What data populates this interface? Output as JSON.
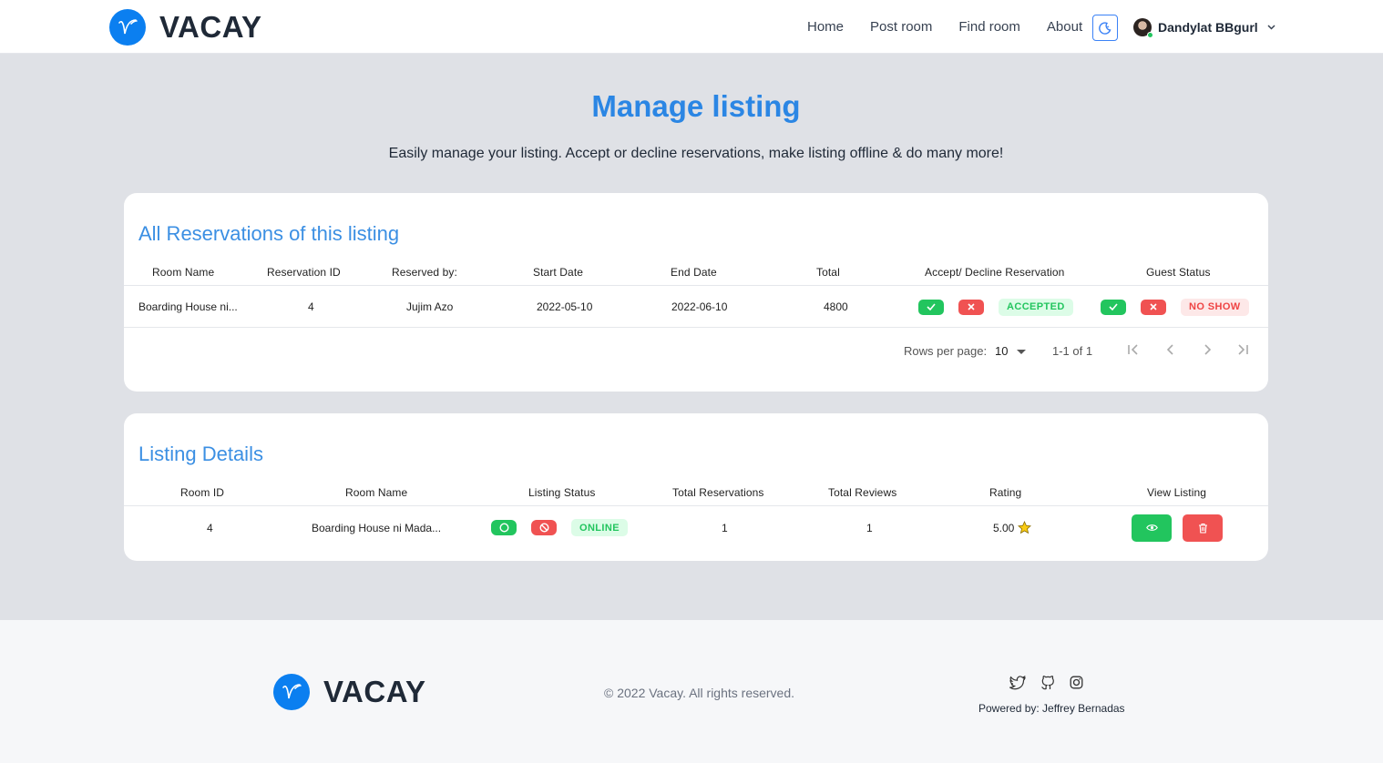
{
  "brand": {
    "name": "VACAY"
  },
  "nav": {
    "links": [
      "Home",
      "Post room",
      "Find room",
      "About"
    ],
    "user_name": "Dandylat BBgurl"
  },
  "page": {
    "title": "Manage listing",
    "subtitle": "Easily manage your listing. Accept or decline reservations, make listing offline & do many more!"
  },
  "reservations": {
    "title": "All Reservations of this listing",
    "columns": [
      "Room Name",
      "Reservation ID",
      "Reserved by:",
      "Start Date",
      "End Date",
      "Total",
      "Accept/ Decline Reservation",
      "Guest Status"
    ],
    "rows": [
      {
        "room_name": "Boarding House ni...",
        "reservation_id": "4",
        "reserved_by": "Jujim Azo",
        "start_date": "2022-05-10",
        "end_date": "2022-06-10",
        "total": "4800",
        "reservation_status": "ACCEPTED",
        "guest_status": "NO SHOW"
      }
    ],
    "pagination": {
      "rows_label": "Rows per page:",
      "rows_value": "10",
      "range": "1-1 of 1"
    }
  },
  "listing": {
    "title": "Listing Details",
    "columns": [
      "Room ID",
      "Room Name",
      "Listing Status",
      "Total Reservations",
      "Total Reviews",
      "Rating",
      "View Listing"
    ],
    "row": {
      "room_id": "4",
      "room_name": "Boarding House ni Mada...",
      "status": "ONLINE",
      "total_reservations": "1",
      "total_reviews": "1",
      "rating": "5.00"
    }
  },
  "footer": {
    "brand": "VACAY",
    "copyright": "© 2022 Vacay. All rights reserved.",
    "powered": "Powered by: Jeffrey Bernadas"
  },
  "colors": {
    "accent": "#2b86e4",
    "green": "#22c55e",
    "red": "#f05252",
    "logo": "#0b7ff0"
  },
  "icons": [
    "moon-icon",
    "chevron-down-icon",
    "check-icon",
    "x-icon",
    "circle-icon",
    "ban-icon",
    "eye-icon",
    "trash-icon",
    "star-icon",
    "twitter-icon",
    "github-icon",
    "instagram-icon"
  ]
}
